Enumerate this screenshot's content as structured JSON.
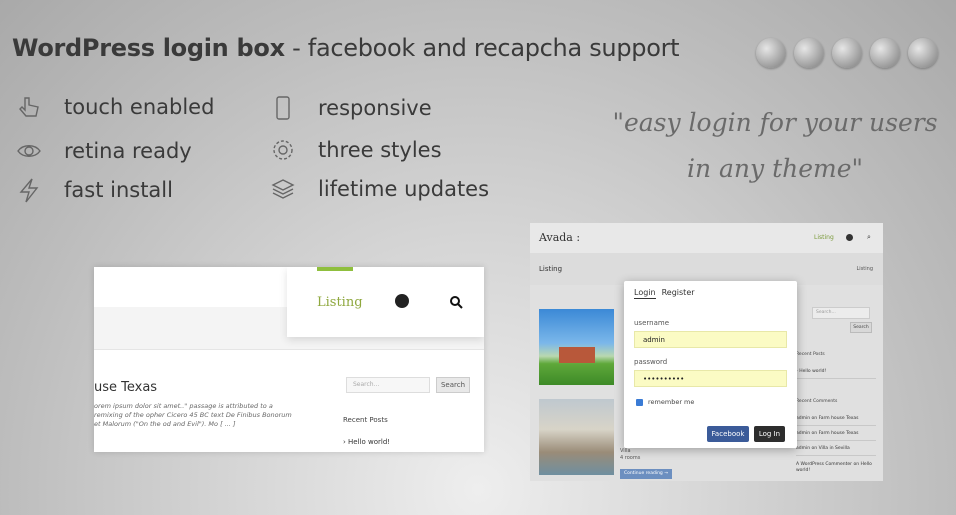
{
  "header": {
    "title_bold": "WordPress login box",
    "title_dash": " - ",
    "title_sub": "facebook and recapcha support",
    "browsers": [
      "opera-icon",
      "firefox-icon",
      "ie-icon",
      "safari-icon",
      "chrome-icon"
    ]
  },
  "features": [
    {
      "label": "touch enabled",
      "icon": "hand-icon"
    },
    {
      "label": "retina ready",
      "icon": "eye-icon"
    },
    {
      "label": "fast install",
      "icon": "lightning-icon"
    },
    {
      "label": "responsive",
      "icon": "phone-icon"
    },
    {
      "label": "three styles",
      "icon": "gear-icon"
    },
    {
      "label": "lifetime updates",
      "icon": "layers-icon"
    }
  ],
  "quote": {
    "line1": "\"easy login for your users",
    "line2": "in any theme\""
  },
  "mock_left": {
    "nav_listing": "Listing",
    "post_title": "use Texas",
    "post_text": "orem ipsum dolor sit amet..\" passage is attributed to a remixing of the opher Cicero 45 BC text De Finibus Bonorum et Malorum (\"On the od and Evil\"). Mo [ ... ]",
    "search_placeholder": "Search...",
    "search_button": "Search",
    "recent_posts": "Recent Posts",
    "hello_world": "Hello world!"
  },
  "mock_right": {
    "logo": "Avada :",
    "nav_listing": "Listing",
    "page_title": "Listing",
    "crumb": "Listing",
    "villa_text": "Villa\n4 rooms",
    "continue": "Continue reading →",
    "sidebar_search": "Search...",
    "sidebar_search_btn": "Search",
    "recent_posts": "Recent Posts",
    "hello": "Hello world!",
    "recent_comments": "Recent Comments",
    "comments": [
      "admin on Farm house Texas",
      "admin on Farm house Texas",
      "admin on Villa in Sevilla",
      "A WordPress Commenter on Hello world!"
    ]
  },
  "login_box": {
    "tab_login": "Login",
    "tab_register": "Register",
    "username_label": "username",
    "username_value": "admin",
    "password_label": "password",
    "password_value": "••••••••••",
    "remember_label": "remember me",
    "facebook_button": "Facebook",
    "login_button": "Log In"
  }
}
